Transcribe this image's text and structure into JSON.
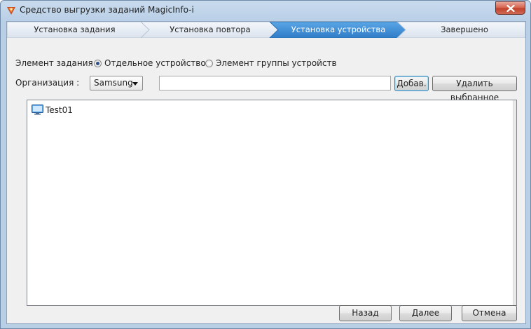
{
  "window": {
    "title": "Средство выгрузки заданий MagicInfo-i",
    "close_label": "x"
  },
  "steps": [
    {
      "label": "Установка задания",
      "active": false
    },
    {
      "label": "Установка повтора",
      "active": false
    },
    {
      "label": "Установка устройства",
      "active": true
    },
    {
      "label": "Завершено",
      "active": false
    }
  ],
  "task_element": {
    "label": "Элемент задания :",
    "options": [
      {
        "label": "Отдельное устройство",
        "selected": true
      },
      {
        "label": "Элемент группы устройств",
        "selected": false
      }
    ]
  },
  "organization": {
    "label": "Организация :",
    "selected": "Samsung",
    "search_value": "",
    "add_label": "Добав.",
    "remove_label": "Удалить выбранное"
  },
  "device_list": {
    "items": [
      {
        "label": "Test01",
        "icon": "monitor-icon"
      }
    ]
  },
  "footer": {
    "back_label": "Назад",
    "next_label": "Далее",
    "cancel_label": "Отмена"
  },
  "colors": {
    "active_step": "#3f8fd6",
    "inactive_step": "#e3e9f2",
    "title_bar": "#c9dbee",
    "close_button": "#c9503c"
  }
}
